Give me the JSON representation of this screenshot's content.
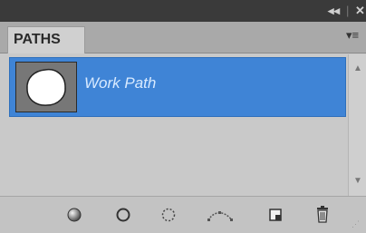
{
  "panel": {
    "tab_label": "PATHS",
    "collapse_glyph": "◂◂",
    "close_glyph": "✕",
    "menu_glyph": "▾≡"
  },
  "paths": [
    {
      "name": "Work Path",
      "selected": true
    }
  ],
  "footer_tools": [
    {
      "name": "fill-path-icon"
    },
    {
      "name": "stroke-path-icon"
    },
    {
      "name": "load-selection-icon"
    },
    {
      "name": "make-work-path-icon"
    },
    {
      "name": "new-path-icon"
    },
    {
      "name": "delete-path-icon"
    }
  ],
  "colors": {
    "selection": "#3f84d6",
    "panel_bg": "#c9c9c9",
    "titlebar": "#3a3a3a"
  }
}
